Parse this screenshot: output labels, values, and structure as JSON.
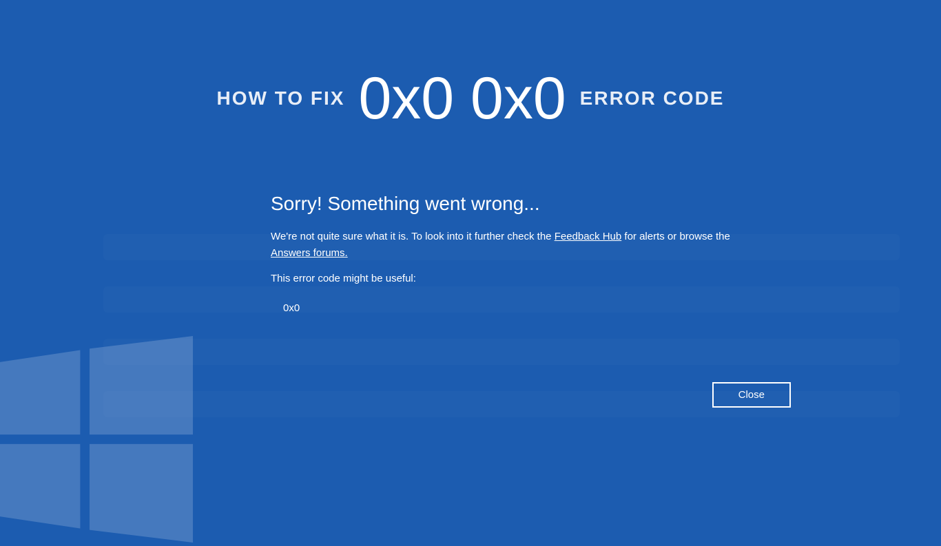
{
  "header": {
    "left": "HOW TO FIX",
    "center": "0x0 0x0",
    "right": "ERROR CODE"
  },
  "dialog": {
    "title": "Sorry! Something went wrong...",
    "body_prefix": "We're not quite sure what it is. To look into it further check the ",
    "link_feedback": "Feedback Hub",
    "body_mid": " for alerts or browse the ",
    "link_answers": "Answers forums.",
    "hint": "This error code might be useful:",
    "error_code": "0x0",
    "close_label": "Close"
  }
}
